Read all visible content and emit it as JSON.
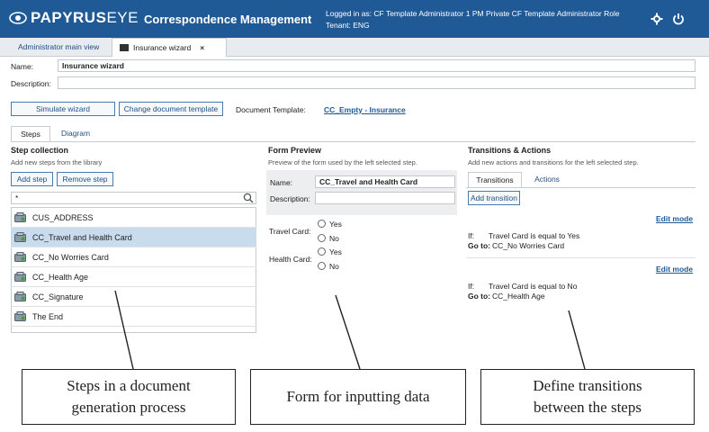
{
  "header": {
    "logo_bold": "PAPYRUS",
    "logo_thin": "EYE",
    "app_title": "Correspondence Management",
    "logged_in": "Logged in as:  CF Template Administrator 1   PM Private CF Template Administrator  Role",
    "tenant": "Tenant: ENG",
    "icons": [
      "settings-icon",
      "power-icon"
    ]
  },
  "tabs": [
    {
      "label": "Administrator main view"
    },
    {
      "label": "Insurance wizard",
      "close": "×"
    }
  ],
  "form": {
    "name_label": "Name:",
    "name_value": "Insurance wizard",
    "description_label": "Description:",
    "description_value": "",
    "simulate_button": "Simulate wizard",
    "change_template_button": "Change document template",
    "doc_template_label": "Document Template:",
    "doc_template_link": "CC_Empty - Insurance"
  },
  "subtabs": [
    "Steps",
    "Diagram"
  ],
  "step_collection": {
    "title": "Step collection",
    "hint": "Add new steps from the library",
    "add_button": "Add step",
    "remove_button": "Remove step",
    "search_value": "*",
    "items": [
      "CUS_ADDRESS",
      "CC_Travel and Health Card",
      "CC_No Worries Card",
      "CC_Health Age",
      "CC_Signature",
      "The End"
    ],
    "selected_index": 1
  },
  "form_preview": {
    "title": "Form Preview",
    "hint": "Preview of the form used by the left selected step.",
    "name_label": "Name:",
    "name_value": "CC_Travel and Health Card",
    "description_label": "Description:",
    "description_value": "",
    "travel_label": "Travel Card:",
    "health_label": "Health Card:",
    "yes": "Yes",
    "no": "No"
  },
  "transitions": {
    "title": "Transitions & Actions",
    "hint": "Add new actions and transitions for the left selected step.",
    "tabs": [
      "Transitions",
      "Actions"
    ],
    "add_button": "Add transition",
    "edit_mode": "Edit mode",
    "if_label": "If:",
    "goto_label": "Go to:",
    "rules": [
      {
        "condition": "Travel Card is equal to Yes",
        "target": "CC_No Worries Card"
      },
      {
        "condition": "Travel Card is equal to No",
        "target": "CC_Health Age"
      }
    ]
  },
  "callouts": [
    {
      "line1": "Steps in a document",
      "line2": "generation process"
    },
    {
      "line1": "Form for inputting data",
      "line2": ""
    },
    {
      "line1": "Define transitions",
      "line2": "between the steps"
    }
  ],
  "colors": {
    "header_bg": "#1f5a96",
    "selected_row": "#c9dcee",
    "link": "#1f5a96"
  }
}
